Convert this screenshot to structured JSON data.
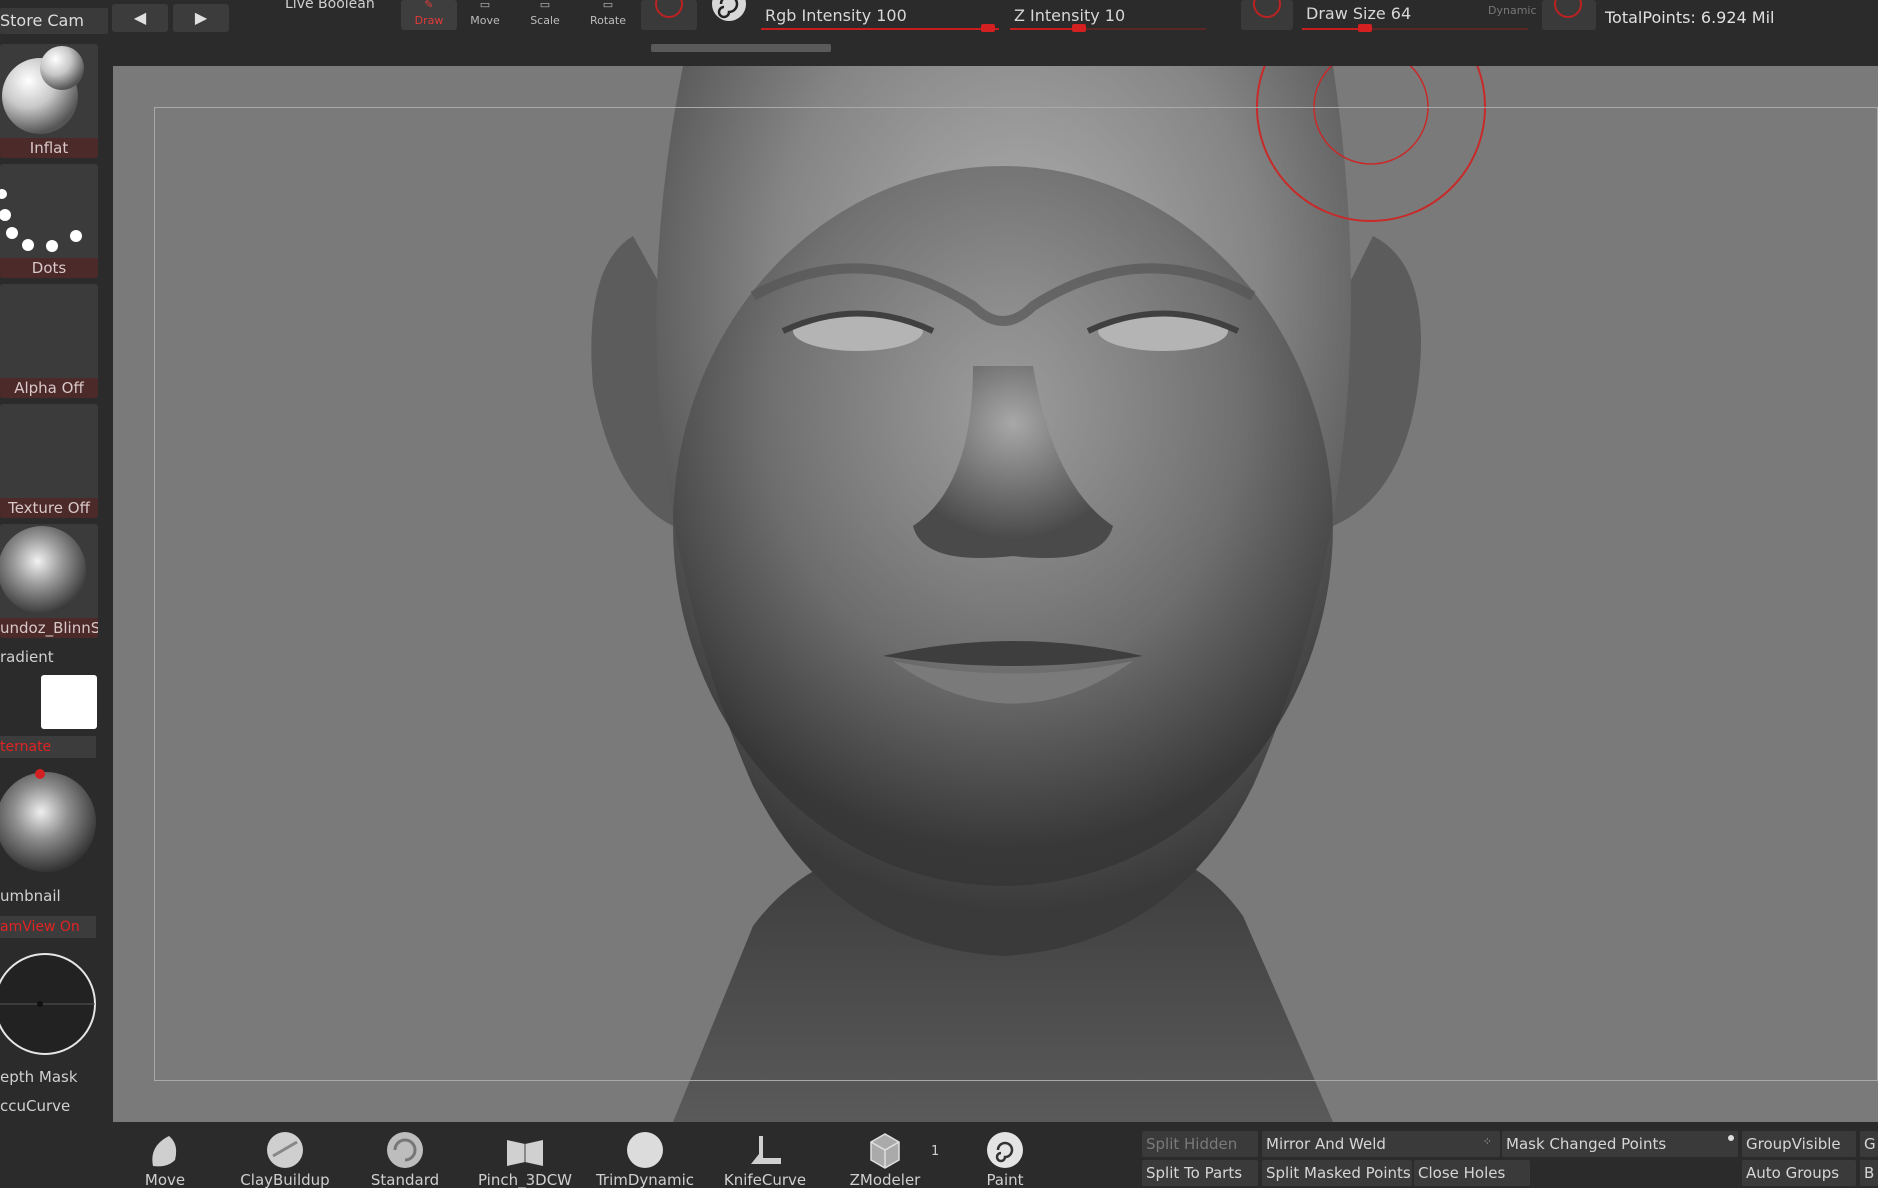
{
  "topbar": {
    "store_cam": "Store Cam",
    "prev_arrow": "◀",
    "next_arrow": "▶",
    "live_boolean": "Live Boolean",
    "tools": {
      "draw": "Draw",
      "move": "Move",
      "scale": "Scale",
      "rotate": "Rotate"
    },
    "rgb_intensity": {
      "label": "Rgb Intensity 100",
      "value": 100
    },
    "z_intensity": {
      "label": "Z Intensity 10",
      "value": 10
    },
    "draw_size": {
      "label": "Draw Size 64",
      "value": 64
    },
    "dynamic": "Dynamic",
    "total_points": "TotalPoints: 6.924 Mil",
    "accent_color": "#d42020"
  },
  "left_shelf": {
    "brush_tile": "Inflat",
    "stroke_tile": "Dots",
    "alpha_tile": "Alpha Off",
    "texture_tile": "Texture Off",
    "material_tile": "undoz_BlinnSh",
    "gradient_label": "radient",
    "alternate_label": "ternate",
    "thumbnail_label": "umbnail",
    "persp_label": "amView On",
    "depth_mask_label": "epth Mask",
    "accucurve_label": "ccuCurve"
  },
  "bottom_shelf": {
    "brushes": [
      {
        "label": "Move",
        "icon": "move-brush-icon"
      },
      {
        "label": "ClayBuildup",
        "icon": "claybuildup-brush-icon"
      },
      {
        "label": "Standard",
        "icon": "standard-brush-icon"
      },
      {
        "label": "Pinch_3DCW",
        "icon": "pinch-brush-icon"
      },
      {
        "label": "TrimDynamic",
        "icon": "trimdynamic-brush-icon"
      },
      {
        "label": "KnifeCurve",
        "icon": "knifecurve-brush-icon"
      },
      {
        "label": "ZModeler",
        "icon": "zmodeler-brush-icon"
      },
      {
        "label": "Paint",
        "icon": "paint-brush-icon"
      }
    ],
    "zmodeler_count": "1",
    "buttons": {
      "split_hidden": "Split Hidden",
      "mirror_and_weld": "Mirror And Weld",
      "mask_changed_points": "Mask Changed Points",
      "group_visible": "GroupVisible",
      "g_trunc": "G",
      "split_to_parts": "Split To Parts",
      "split_masked_points": "Split Masked Points",
      "close_holes": "Close Holes",
      "auto_groups": "Auto Groups",
      "b_trunc": "B"
    }
  }
}
